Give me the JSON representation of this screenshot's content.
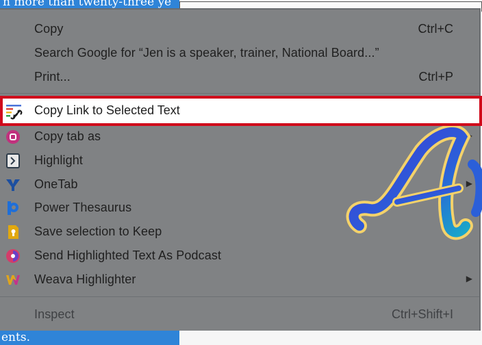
{
  "background": {
    "top_text": "n more than twenty-three ye",
    "bottom_text": "ents."
  },
  "menu": {
    "items": [
      {
        "label": "Copy",
        "shortcut": "Ctrl+C"
      },
      {
        "label": "Search Google for “Jen is a speaker, trainer, National Board...”",
        "shortcut": ""
      },
      {
        "label": "Print...",
        "shortcut": "Ctrl+P"
      }
    ],
    "highlighted": {
      "label": "Copy Link to Selected Text",
      "icon": "link-highlight-icon"
    },
    "extensions": [
      {
        "label": "Copy tab as",
        "icon": "copy-tab-icon",
        "color": "#c0317d",
        "submenu": true
      },
      {
        "label": "Highlight",
        "icon": "highlight-icon",
        "color": "#2d3b49",
        "submenu": false
      },
      {
        "label": "OneTab",
        "icon": "onetab-icon",
        "color": "#1c4fa0",
        "submenu": true
      },
      {
        "label": "Power Thesaurus",
        "icon": "power-thesaurus-icon",
        "color": "#1f6fd8",
        "submenu": false
      },
      {
        "label": "Save selection to Keep",
        "icon": "keep-icon",
        "color": "#e1a80f",
        "submenu": false
      },
      {
        "label": "Send Highlighted Text As Podcast",
        "icon": "podcast-icon",
        "color": "#d43c6a",
        "submenu": false
      },
      {
        "label": "Weava Highlighter",
        "icon": "weava-icon",
        "color": "#e0a51d",
        "submenu": true
      }
    ],
    "inspect": {
      "label": "Inspect",
      "shortcut": "Ctrl+Shift+I"
    }
  },
  "colors": {
    "highlight_border": "#d0091b",
    "selection": "#2f84d8"
  }
}
